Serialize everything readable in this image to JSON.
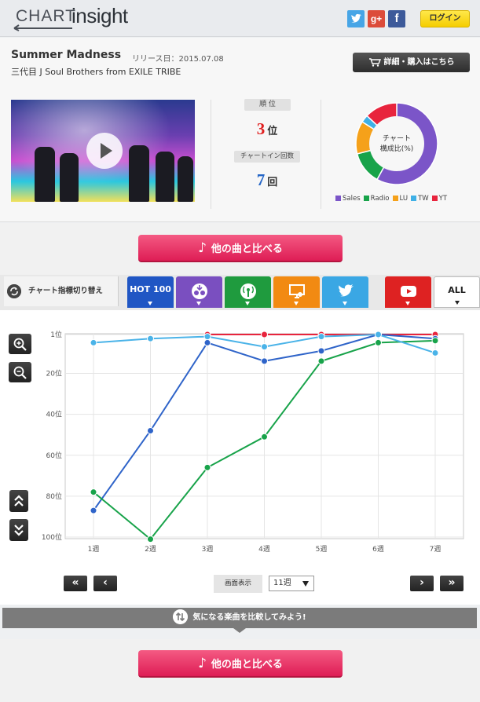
{
  "header": {
    "logo_chart": "CHART",
    "logo_insight": "insight",
    "twitter": "t",
    "google": "g+",
    "facebook": "f",
    "login": "ログイン"
  },
  "song": {
    "title": "Summer Madness",
    "release": "リリース日：2015.07.08",
    "artist": "三代目 J Soul Brothers from EXILE TRIBE",
    "detail_button": "詳細・購入はこちら"
  },
  "stats": {
    "rank_label": "順 位",
    "rank_value": "3",
    "rank_unit": "位",
    "chartin_label": "チャートイン回数",
    "chartin_value": "7",
    "chartin_unit": "回"
  },
  "composition": {
    "center_line1": "チャート",
    "center_line2": "構成比(%)",
    "segments": [
      {
        "name": "Sales",
        "value": 58,
        "color": "#7b55c8"
      },
      {
        "name": "Radio",
        "value": 13,
        "color": "#18a34a"
      },
      {
        "name": "LU",
        "value": 13,
        "color": "#f5a11a"
      },
      {
        "name": "TW",
        "value": 3,
        "color": "#3fb0e6"
      },
      {
        "name": "YT",
        "value": 13,
        "color": "#e8243d"
      }
    ]
  },
  "compare_button": "他の曲と比べる",
  "compare_note": "♪",
  "tabs": {
    "switch_label": "チャート指標切り替え",
    "hot100": "HOT 100",
    "all": "ALL",
    "colors": {
      "hot100": "#2056c4",
      "sales": "#7a4fc0",
      "radio": "#1f9b3e",
      "lookup": "#f28a12",
      "twitter": "#3aa7e4",
      "youtube": "#de2222"
    }
  },
  "controls": {
    "display_label": "画面表示",
    "display_value": "11週",
    "first": "«",
    "prev": "‹",
    "next": "›",
    "last": "»"
  },
  "hint": "気になる楽曲を比較してみよう!",
  "chart_data": {
    "type": "line",
    "categories": [
      "1週",
      "2週",
      "3週",
      "4週",
      "5週",
      "6週",
      "7週"
    ],
    "yticks": [
      1,
      20,
      40,
      60,
      80,
      100
    ],
    "ytick_suffix": "位",
    "ylim": [
      1,
      100
    ],
    "inverted": true,
    "series": [
      {
        "key": "youtube",
        "color": "#e8243d",
        "values": [
          null,
          null,
          1,
          1,
          1,
          1,
          1
        ]
      },
      {
        "key": "hot100",
        "color": "#2f64c9",
        "values": [
          87,
          48,
          5,
          14,
          9,
          1,
          3
        ]
      },
      {
        "key": "radio",
        "color": "#18a34a",
        "values": [
          78,
          101,
          66,
          51,
          14,
          5,
          4
        ]
      },
      {
        "key": "twitter",
        "color": "#4ab3e8",
        "values": [
          5,
          3,
          2,
          7,
          2,
          1,
          10
        ]
      }
    ]
  }
}
